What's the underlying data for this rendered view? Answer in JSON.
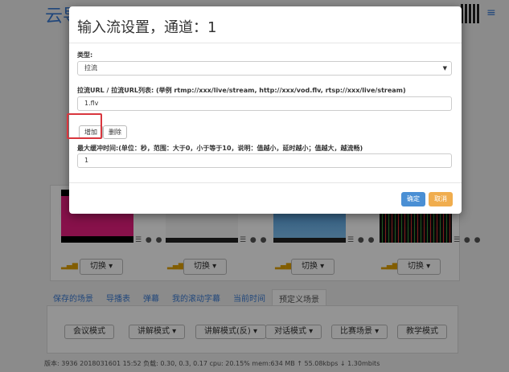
{
  "background": {
    "title": "云导播台",
    "menu_icon": "≡",
    "channel_controls": "☰ ● ●",
    "switch_label": "切换 ▾",
    "tabs": [
      "保存的场景",
      "导播表",
      "弹幕",
      "我的滚动字幕",
      "当前时间",
      "预定义场景"
    ],
    "scene_buttons": [
      "会议模式",
      "讲解模式 ▾",
      "讲解模式(反) ▾",
      "对话模式 ▾",
      "比赛场景 ▾",
      "教学模式"
    ],
    "status_line": "版本: 3936 2018031601 15:52   负载: 0.30, 0.3, 0.17   cpu: 20.15%   mem:634 MB   ↑ 55.08kbps   ↓ 1.30mbits"
  },
  "modal": {
    "title": "输入流设置，通道：1",
    "type_label": "类型:",
    "type_value": "拉流",
    "url_label": "拉流URL / 拉流URL列表: (举例 rtmp://xxx/live/stream, http://xxx/vod.flv, rtsp://xxx/live/stream)",
    "url_value": "1.flv",
    "add_button": "增加",
    "delete_button": "删除",
    "buffer_label": "最大缓冲时间:(单位：秒，范围：大于0，小于等于10，说明：值越小，延时越小；值越大，越流畅)",
    "buffer_value": "1",
    "ok_button": "确定",
    "cancel_button": "取消"
  },
  "colors": {
    "primary": "#4a8fd4",
    "warning": "#f0ad4e",
    "highlight": "#d9363e"
  }
}
